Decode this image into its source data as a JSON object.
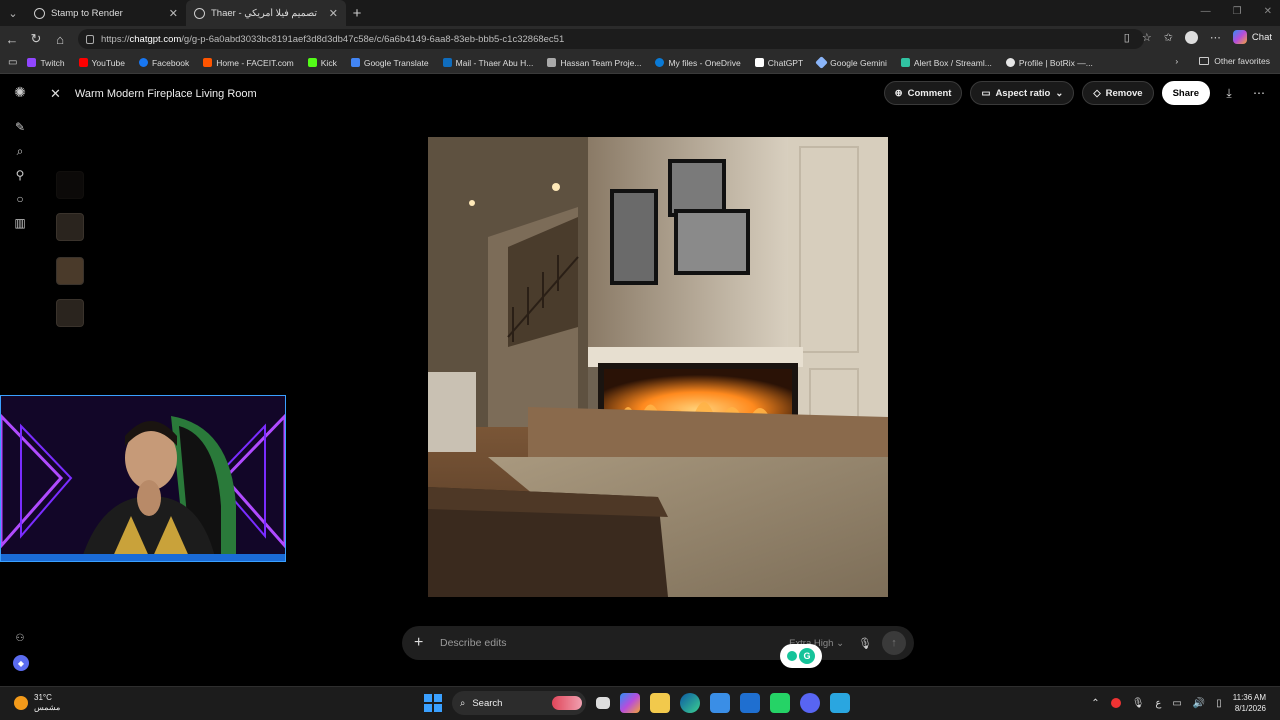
{
  "browser": {
    "tabs": [
      {
        "title": "Stamp to Render",
        "active": false
      },
      {
        "title": "Thaer - تصميم فيلا أمريكي",
        "active": true
      }
    ],
    "url_prefix": "https://",
    "url_host": "chatgpt.com",
    "url_path": "/g/g-p-6a0abd3033bc8191aef3d8d3db47c58e/c/6a6b4149-6aa8-83eb-bbb5-c1c32868ec51",
    "chat_label": "Chat",
    "bookmarks": [
      "Twitch",
      "YouTube",
      "Facebook",
      "Home - FACEIT.com",
      "Kick",
      "Google Translate",
      "Mail - Thaer Abu H...",
      "Hassan Team Proje...",
      "My files - OneDrive",
      "ChatGPT",
      "Google Gemini",
      "Alert Box / Streaml...",
      "Profile | BotRix —..."
    ],
    "bookmark_colors": [
      "#9146ff",
      "#ff0000",
      "#1877f2",
      "#ff5500",
      "#53fc18",
      "#4285f4",
      "#0f6cbd",
      "#aaaaaa",
      "#0a7ad6",
      "#ffffff",
      "#8ab4f8",
      "#31c3a2",
      "#e6e6e6"
    ],
    "other_favorites": "Other favorites"
  },
  "editor": {
    "title": "Warm Modern Fireplace Living Room",
    "comment_label": "Comment",
    "aspect_label": "Aspect ratio",
    "remove_label": "Remove",
    "share_label": "Share"
  },
  "composer": {
    "placeholder": "Describe edits",
    "quality": "Extra High"
  },
  "taskbar": {
    "temp": "31°C",
    "condition": "مشمس",
    "search": "Search",
    "lang": "ع",
    "time": "11:36 AM",
    "date": "8/1/2026"
  }
}
